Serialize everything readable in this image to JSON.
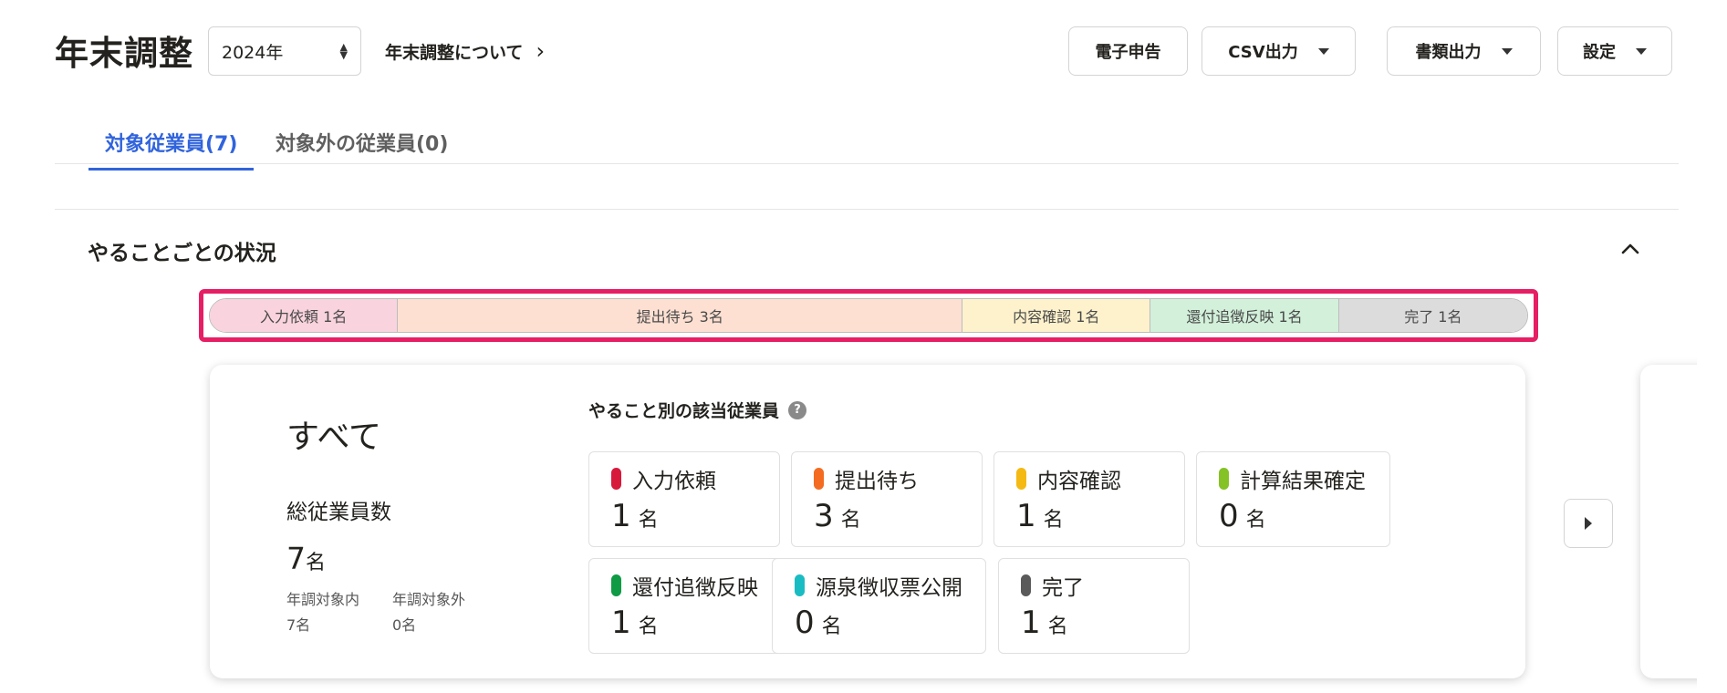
{
  "header": {
    "title": "年末調整",
    "year_select": {
      "value": "2024年"
    },
    "about_link": "年末調整について",
    "buttons": {
      "e_filing": "電子申告",
      "csv_export": "CSV出力",
      "document_export": "書類出力",
      "settings": "設定"
    }
  },
  "tabs": [
    {
      "label": "対象従業員(7)",
      "active": true
    },
    {
      "label": "対象外の従業員(0)",
      "active": false
    }
  ],
  "section": {
    "title": "やることごとの状況"
  },
  "status_bar": {
    "segments": [
      {
        "label": "入力依頼 1名",
        "count": 1,
        "color": "#f9d3dd"
      },
      {
        "label": "提出待ち 3名",
        "count": 3,
        "color": "#fde0d2"
      },
      {
        "label": "内容確認 1名",
        "count": 1,
        "color": "#fdf2cc"
      },
      {
        "label": "還付追徴反映 1名",
        "count": 1,
        "color": "#d2f0da"
      },
      {
        "label": "完了 1名",
        "count": 1,
        "color": "#dcdcdc"
      }
    ]
  },
  "card": {
    "title": "すべて",
    "total_label": "総従業員数",
    "total_value": "7",
    "total_unit": "名",
    "in_scope_label": "年調対象内",
    "in_scope_value": "7名",
    "out_scope_label": "年調対象外",
    "out_scope_value": "0名",
    "tasks_title": "やること別の該当従業員",
    "help_glyph": "?",
    "tasks": [
      {
        "label": "入力依頼",
        "value": "1",
        "unit": "名",
        "color": "#d7193c"
      },
      {
        "label": "提出待ち",
        "value": "3",
        "unit": "名",
        "color": "#f36c21"
      },
      {
        "label": "内容確認",
        "value": "1",
        "unit": "名",
        "color": "#f5b914"
      },
      {
        "label": "計算結果確定",
        "value": "0",
        "unit": "名",
        "color": "#84c225"
      },
      {
        "label": "還付追徴反映",
        "value": "1",
        "unit": "名",
        "color": "#0f9a46"
      },
      {
        "label": "源泉徴収票公開",
        "value": "0",
        "unit": "名",
        "color": "#19bcc2"
      },
      {
        "label": "完了",
        "value": "1",
        "unit": "名",
        "color": "#5a5a5a"
      }
    ]
  }
}
